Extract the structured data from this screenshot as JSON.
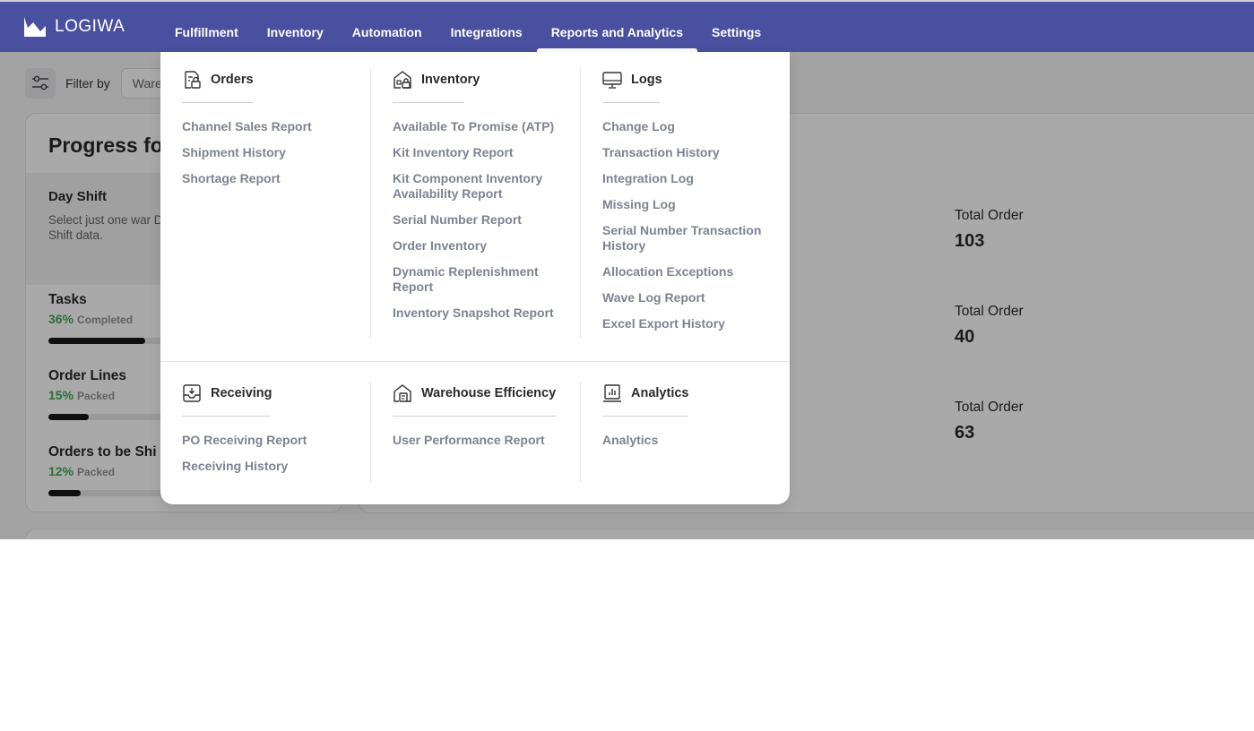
{
  "brand": {
    "name": "LOGIWA"
  },
  "nav": {
    "items": [
      {
        "label": "Fulfillment"
      },
      {
        "label": "Inventory"
      },
      {
        "label": "Automation"
      },
      {
        "label": "Integrations"
      },
      {
        "label": "Reports and Analytics",
        "active": true
      },
      {
        "label": "Settings"
      }
    ]
  },
  "filter": {
    "label": "Filter by",
    "select_value": "Ware"
  },
  "progress_card": {
    "title": "Progress fo",
    "shift": {
      "title": "Day Shift",
      "description": "Select just one war Day Shift data."
    },
    "metrics": [
      {
        "name": "Tasks",
        "percent": "36%",
        "status": "Completed",
        "fill": 0.36
      },
      {
        "name": "Order Lines",
        "percent": "15%",
        "status": "Packed",
        "fill": 0.15
      },
      {
        "name": "Orders to be Shi",
        "percent": "12%",
        "status": "Packed",
        "fill": 0.12
      }
    ]
  },
  "totals": [
    {
      "label": "Total Order",
      "value": "103"
    },
    {
      "label": "Total Order",
      "value": "40"
    },
    {
      "label": "Total Order",
      "value": "63"
    }
  ],
  "menu": {
    "orders": {
      "title": "Orders",
      "icon": "orders-icon",
      "links": [
        "Channel Sales Report",
        "Shipment History",
        "Shortage Report"
      ]
    },
    "inventory": {
      "title": "Inventory",
      "icon": "warehouse-lock-icon",
      "links": [
        "Available To Promise (ATP)",
        "Kit Inventory Report",
        "Kit Component Inventory Availability Report",
        "Serial Number Report",
        "Order Inventory",
        "Dynamic Replenishment Report",
        "Inventory Snapshot Report"
      ]
    },
    "logs": {
      "title": "Logs",
      "icon": "monitor-icon",
      "links": [
        "Change Log",
        "Transaction History",
        "Integration Log",
        "Missing Log",
        "Serial Number Transaction History",
        "Allocation Exceptions",
        "Wave Log Report",
        "Excel Export History"
      ]
    },
    "receiving": {
      "title": "Receiving",
      "icon": "inbox-icon",
      "links": [
        "PO Receiving Report",
        "Receiving History"
      ]
    },
    "warehouse_efficiency": {
      "title": "Warehouse Efficiency",
      "icon": "warehouse-doc-icon",
      "links": [
        "User Performance Report"
      ]
    },
    "analytics": {
      "title": "Analytics",
      "icon": "analytics-chart-icon",
      "links": [
        "Analytics"
      ]
    }
  },
  "colors": {
    "topbar": "#4a50a0",
    "accent_green": "#2ea043",
    "link_gray": "#7d8390"
  }
}
